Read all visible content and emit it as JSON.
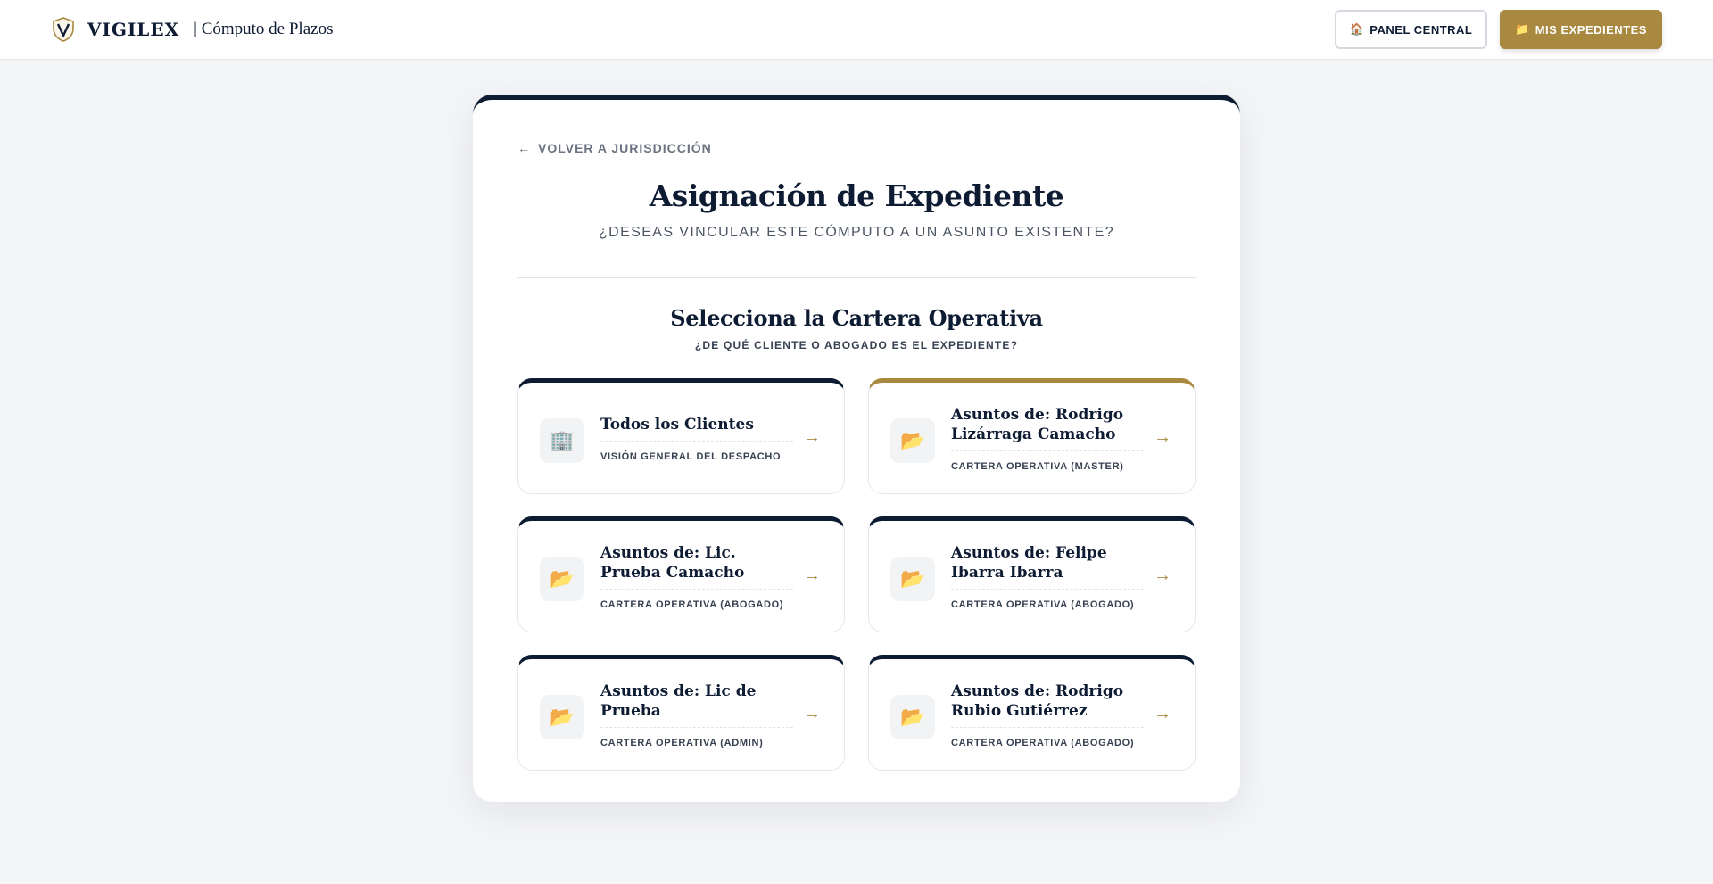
{
  "header": {
    "brand": "VIGILEX",
    "module": "| Cómputo de Plazos",
    "panel_icon": "🏠",
    "panel_label": "PANEL CENTRAL",
    "expedientes_icon": "📁",
    "expedientes_label": "MIS EXPEDIENTES"
  },
  "card": {
    "back_label": "VOLVER A JURISDICCIÓN",
    "title": "Asignación de Expediente",
    "subtitle": "¿DESEAS VINCULAR ESTE CÓMPUTO A UN ASUNTO EXISTENTE?",
    "section_title": "Selecciona la Cartera Operativa",
    "section_subtitle": "¿DE QUÉ CLIENTE O ABOGADO ES EL EXPEDIENTE?"
  },
  "options": [
    {
      "icon": "🏢",
      "name": "Todos los Clientes",
      "role": "VISIÓN GENERAL DEL DESPACHO"
    },
    {
      "icon": "📂",
      "name": "Asuntos de: Rodrigo Lizárraga Camacho",
      "role": "CARTERA OPERATIVA (MASTER)"
    },
    {
      "icon": "📂",
      "name": "Asuntos de: Lic. Prueba Camacho",
      "role": "CARTERA OPERATIVA (ABOGADO)"
    },
    {
      "icon": "📂",
      "name": "Asuntos de: Felipe Ibarra Ibarra",
      "role": "CARTERA OPERATIVA (ABOGADO)"
    },
    {
      "icon": "📂",
      "name": "Asuntos de: Lic de Prueba",
      "role": "CARTERA OPERATIVA (ADMIN)"
    },
    {
      "icon": "📂",
      "name": "Asuntos de: Rodrigo Rubio Gutiérrez",
      "role": "CARTERA OPERATIVA (ABOGADO)"
    }
  ],
  "arrow": "→",
  "back_arrow": "←",
  "colors": {
    "navy": "#0d1b33",
    "gold": "#a8893f",
    "background": "#f4f5f7"
  }
}
